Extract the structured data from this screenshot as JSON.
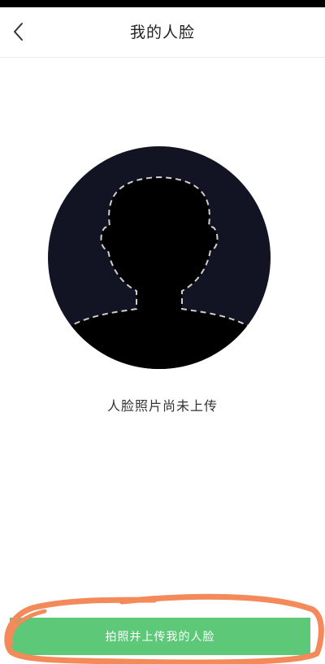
{
  "header": {
    "title": "我的人脸",
    "back_icon": "chevron-left-icon"
  },
  "main": {
    "avatar_icon": "face-silhouette-placeholder-icon",
    "status_text": "人脸照片尚未上传"
  },
  "footer": {
    "button_label": "拍照并上传我的人脸"
  },
  "colors": {
    "button_bg": "#5cc878",
    "avatar_bg": "#121424",
    "annotation_stroke": "#f4895a"
  }
}
